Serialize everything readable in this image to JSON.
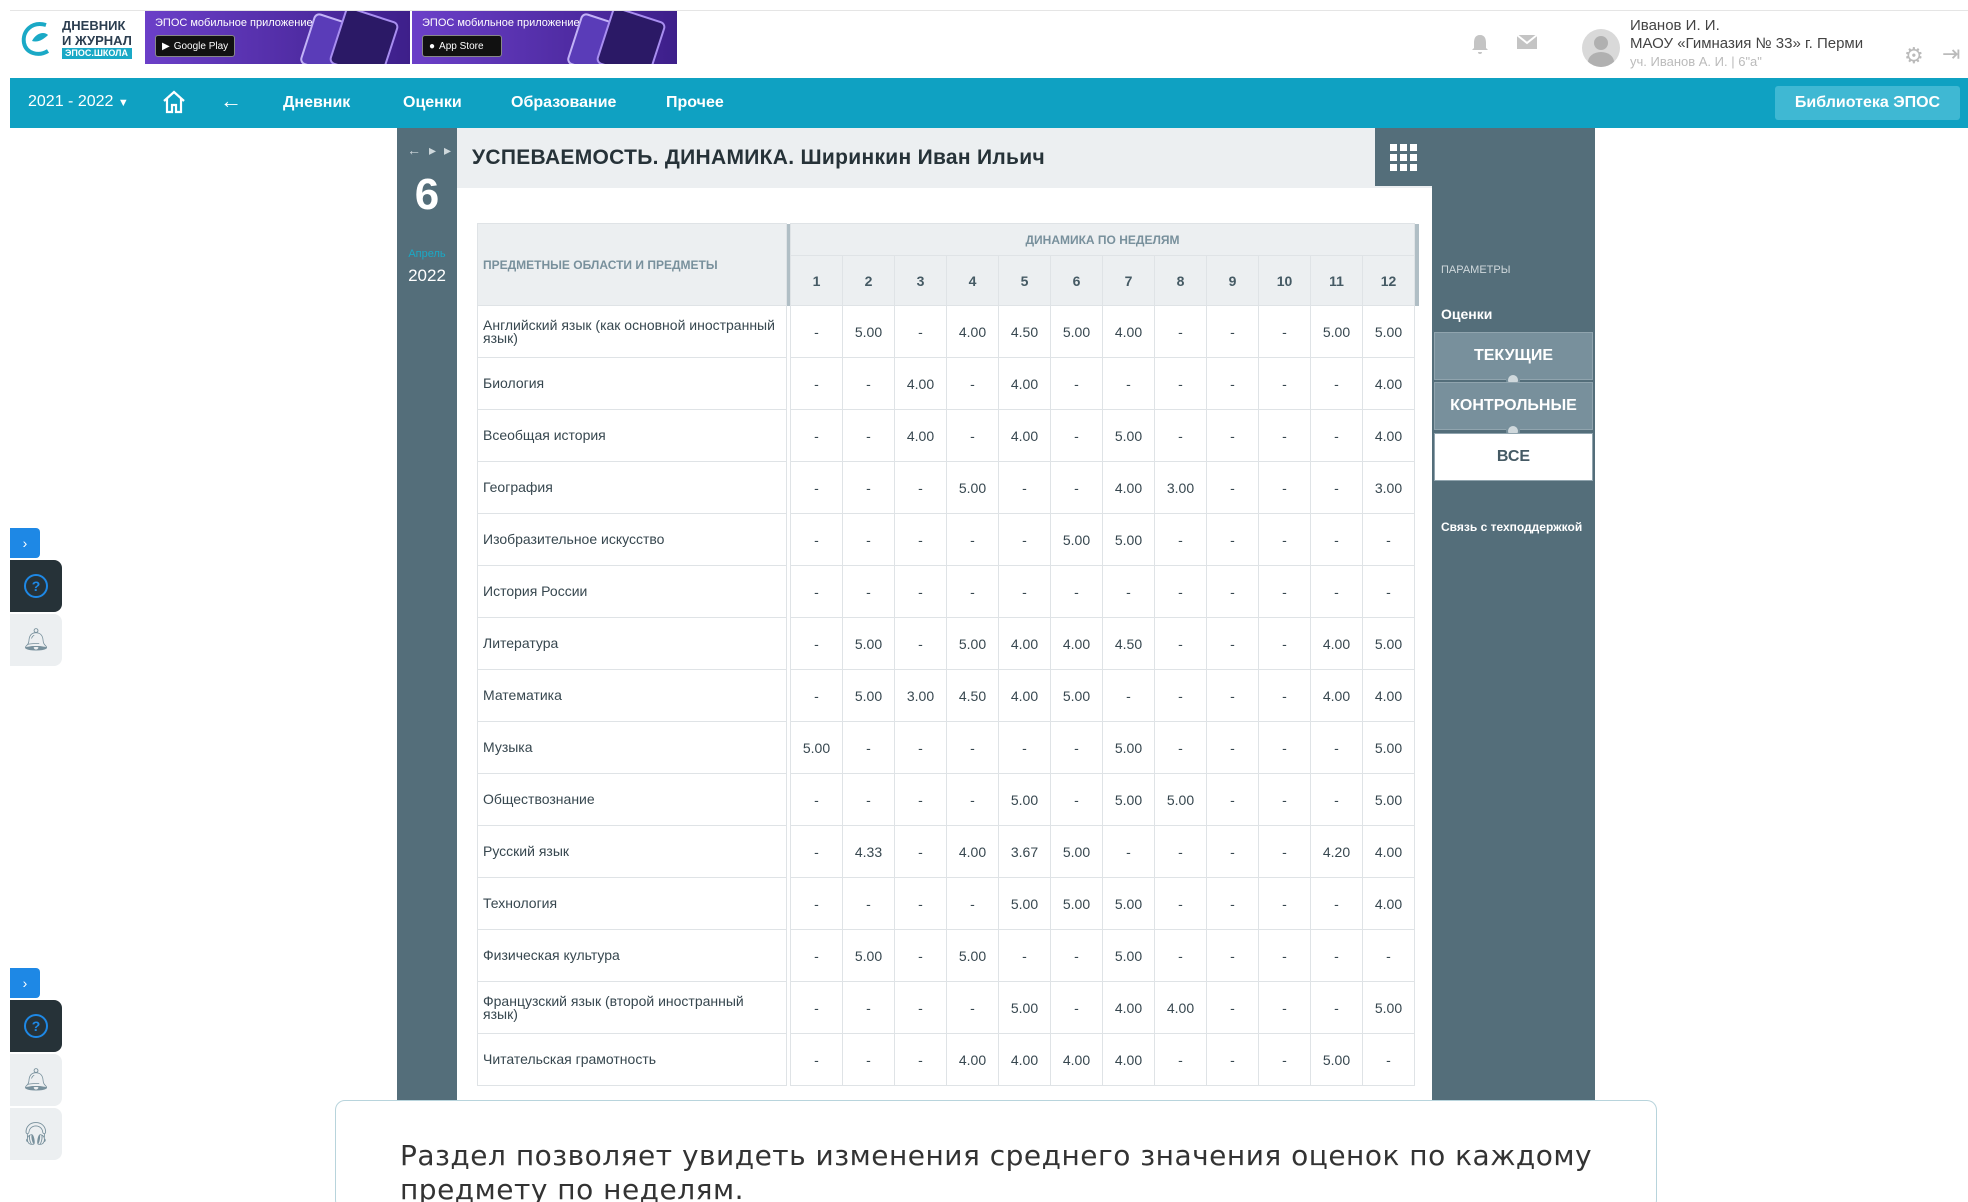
{
  "header": {
    "logo_line1": "ДНЕВНИК",
    "logo_line2": "И ЖУРНАЛ",
    "logo_sub": "ЭПОС.ШКОЛА",
    "banners": [
      {
        "title": "ЭПОС мобильное приложение",
        "store": "Google Play"
      },
      {
        "title": "ЭПОС мобильное приложение",
        "store": "App Store"
      }
    ],
    "user_name": "Иванов И. И.",
    "user_school": "МАОУ «Гимназия № 33» г. Перми",
    "user_role": "уч. Иванов А. И. | 6\"а\""
  },
  "nav": {
    "year": "2021 - 2022",
    "links": [
      "Дневник",
      "Оценки",
      "Образование",
      "Прочее"
    ],
    "active": "Оценки",
    "library": "Библиотека ЭПОС"
  },
  "date": {
    "day": "6",
    "month": "Апрель",
    "year": "2022"
  },
  "page": {
    "title": "УСПЕВАЕМОСТЬ. ДИНАМИКА. Ширинкин Иван Ильич"
  },
  "table": {
    "subject_header": "ПРЕДМЕТНЫЕ ОБЛАСТИ И ПРЕДМЕТЫ",
    "group_header": "ДИНАМИКА ПО НЕДЕЛЯМ",
    "weeks": [
      "1",
      "2",
      "3",
      "4",
      "5",
      "6",
      "7",
      "8",
      "9",
      "10",
      "11",
      "12"
    ],
    "rows": [
      {
        "subject": "Английский язык (как основной иностранный язык)",
        "values": [
          "-",
          "5.00",
          "-",
          "4.00",
          "4.50",
          "5.00",
          "4.00",
          "-",
          "-",
          "-",
          "5.00",
          "5.00"
        ]
      },
      {
        "subject": "Биология",
        "values": [
          "-",
          "-",
          "4.00",
          "-",
          "4.00",
          "-",
          "-",
          "-",
          "-",
          "-",
          "-",
          "4.00"
        ]
      },
      {
        "subject": "Всеобщая история",
        "values": [
          "-",
          "-",
          "4.00",
          "-",
          "4.00",
          "-",
          "5.00",
          "-",
          "-",
          "-",
          "-",
          "4.00"
        ]
      },
      {
        "subject": "География",
        "values": [
          "-",
          "-",
          "-",
          "5.00",
          "-",
          "-",
          "4.00",
          "3.00",
          "-",
          "-",
          "-",
          "3.00"
        ]
      },
      {
        "subject": "Изобразительное искусство",
        "values": [
          "-",
          "-",
          "-",
          "-",
          "-",
          "5.00",
          "5.00",
          "-",
          "-",
          "-",
          "-",
          "-"
        ]
      },
      {
        "subject": "История России",
        "values": [
          "-",
          "-",
          "-",
          "-",
          "-",
          "-",
          "-",
          "-",
          "-",
          "-",
          "-",
          "-"
        ]
      },
      {
        "subject": "Литература",
        "values": [
          "-",
          "5.00",
          "-",
          "5.00",
          "4.00",
          "4.00",
          "4.50",
          "-",
          "-",
          "-",
          "4.00",
          "5.00"
        ]
      },
      {
        "subject": "Математика",
        "values": [
          "-",
          "5.00",
          "3.00",
          "4.50",
          "4.00",
          "5.00",
          "-",
          "-",
          "-",
          "-",
          "4.00",
          "4.00"
        ]
      },
      {
        "subject": "Музыка",
        "values": [
          "5.00",
          "-",
          "-",
          "-",
          "-",
          "-",
          "5.00",
          "-",
          "-",
          "-",
          "-",
          "5.00"
        ]
      },
      {
        "subject": "Обществознание",
        "values": [
          "-",
          "-",
          "-",
          "-",
          "5.00",
          "-",
          "5.00",
          "5.00",
          "-",
          "-",
          "-",
          "5.00"
        ]
      },
      {
        "subject": "Русский язык",
        "values": [
          "-",
          "4.33",
          "-",
          "4.00",
          "3.67",
          "5.00",
          "-",
          "-",
          "-",
          "-",
          "4.20",
          "4.00"
        ]
      },
      {
        "subject": "Технология",
        "values": [
          "-",
          "-",
          "-",
          "-",
          "5.00",
          "5.00",
          "5.00",
          "-",
          "-",
          "-",
          "-",
          "4.00"
        ]
      },
      {
        "subject": "Физическая культура",
        "values": [
          "-",
          "5.00",
          "-",
          "5.00",
          "-",
          "-",
          "5.00",
          "-",
          "-",
          "-",
          "-",
          "-"
        ]
      },
      {
        "subject": "Французский язык (второй иностранный язык)",
        "values": [
          "-",
          "-",
          "-",
          "-",
          "5.00",
          "-",
          "4.00",
          "4.00",
          "-",
          "-",
          "-",
          "5.00"
        ]
      },
      {
        "subject": "Читательская грамотность",
        "values": [
          "-",
          "-",
          "-",
          "4.00",
          "4.00",
          "4.00",
          "4.00",
          "-",
          "-",
          "-",
          "5.00",
          "-"
        ]
      }
    ]
  },
  "sidebar": {
    "params": "ПАРАМЕТРЫ",
    "grades": "Оценки",
    "modes": [
      "ТЕКУЩИЕ",
      "КОНТРОЛЬНЫЕ",
      "ВСЕ"
    ],
    "active_mode": "ВСЕ",
    "support": "Связь с техподдержкой"
  },
  "tooltip": {
    "text": "Раздел позволяет увидеть изменения среднего значения оценок по каждому предмету по неделям."
  },
  "colors": {
    "brand": "#0fa1c2",
    "panel_dark": "#546e7a",
    "accent_blue": "#1e88e5"
  }
}
